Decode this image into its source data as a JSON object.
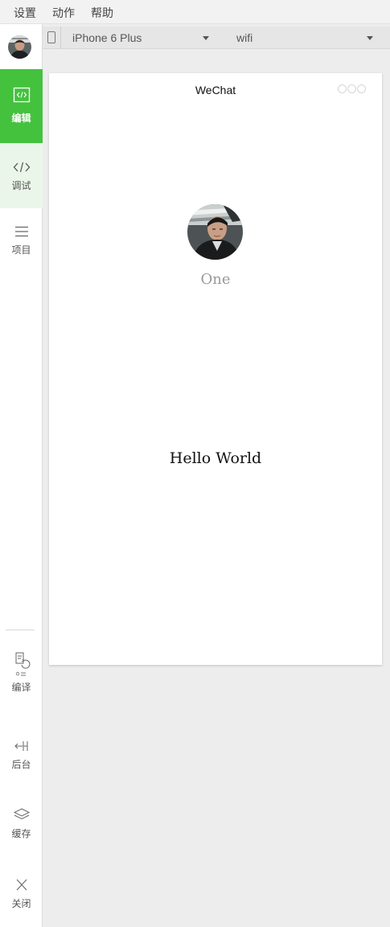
{
  "menu": [
    "设置",
    "动作",
    "帮助"
  ],
  "sidebar": {
    "top": [
      {
        "label": "编辑"
      },
      {
        "label": "调试"
      },
      {
        "label": "项目"
      }
    ],
    "bottom": [
      {
        "label": "编译"
      },
      {
        "label": "后台"
      },
      {
        "label": "缓存"
      },
      {
        "label": "关闭"
      }
    ]
  },
  "toolbar": {
    "device": "iPhone 6 Plus",
    "network": "wifi"
  },
  "simulator": {
    "nav_title": "WeChat",
    "nickname": "One",
    "hello": "Hello World"
  },
  "colors": {
    "accent": "#44c23e",
    "accent_light": "#eaf6e9"
  }
}
